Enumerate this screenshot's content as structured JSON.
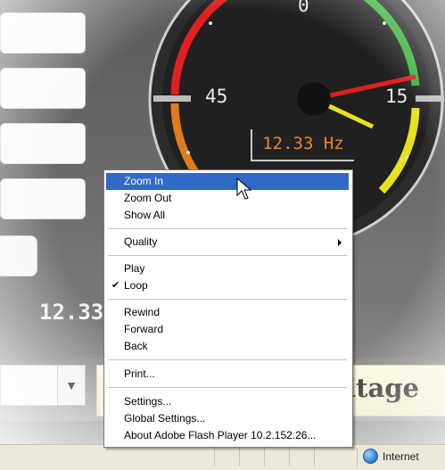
{
  "gauge": {
    "tick_top": "0",
    "tick_left": "45",
    "tick_right": "15",
    "frequency": "12.33 Hz",
    "colors": {
      "red": "#e02020",
      "orange": "#e07a1e",
      "yellow": "#e7e11e",
      "green": "#3cb33c"
    }
  },
  "left_readout": "12.33",
  "voltage_button_label": "ltage",
  "context_menu": {
    "zoom_in": "Zoom In",
    "zoom_out": "Zoom Out",
    "show_all": "Show All",
    "quality": "Quality",
    "play": "Play",
    "loop": "Loop",
    "rewind": "Rewind",
    "forward": "Forward",
    "back": "Back",
    "print": "Print...",
    "settings": "Settings...",
    "global_settings": "Global Settings...",
    "about": "About Adobe Flash Player 10.2.152.26..."
  },
  "status_bar": {
    "zone": "Internet",
    "zone_icon": "globe-icon"
  }
}
